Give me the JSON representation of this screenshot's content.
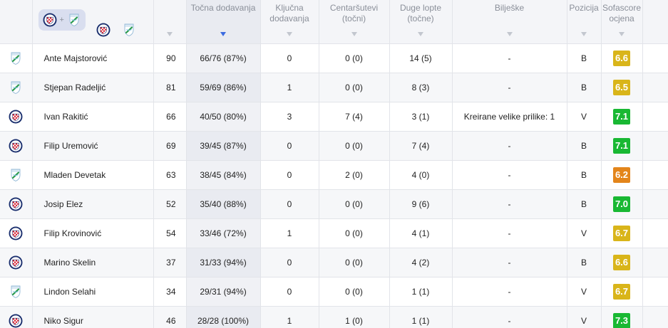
{
  "colors": {
    "rating_yellow": "#d9b51a",
    "rating_orange": "#e3851b",
    "rating_green": "#19b833",
    "sort_active": "#3b6be0"
  },
  "header": {
    "team_filter_plus": "+",
    "sort_column": "accurate_passes",
    "columns": {
      "minutes": "",
      "accurate_passes": "Točna dodavanja",
      "key_passes": "Ključna dodavanja",
      "crosses": "Centaršutevi (točni)",
      "long_balls": "Duge lopte (točne)",
      "notes": "Bilješke",
      "position": "Pozicija",
      "rating": "Sofascore ocjena"
    }
  },
  "players": [
    {
      "team": "rijeka",
      "name": "Ante Majstorović",
      "minutes": "90",
      "accurate_passes": "66/76 (87%)",
      "key_passes": "0",
      "crosses": "0 (0)",
      "long_balls": "14 (5)",
      "notes": "-",
      "position": "B",
      "rating": "6.6",
      "rating_color": "yellow"
    },
    {
      "team": "rijeka",
      "name": "Stjepan Radeljić",
      "minutes": "81",
      "accurate_passes": "59/69 (86%)",
      "key_passes": "1",
      "crosses": "0 (0)",
      "long_balls": "8 (3)",
      "notes": "-",
      "position": "B",
      "rating": "6.5",
      "rating_color": "yellow"
    },
    {
      "team": "hajduk",
      "name": "Ivan Rakitić",
      "minutes": "66",
      "accurate_passes": "40/50 (80%)",
      "key_passes": "3",
      "crosses": "7 (4)",
      "long_balls": "3 (1)",
      "notes": "Kreirane velike prilike: 1",
      "position": "V",
      "rating": "7.1",
      "rating_color": "green"
    },
    {
      "team": "hajduk",
      "name": "Filip Uremović",
      "minutes": "69",
      "accurate_passes": "39/45 (87%)",
      "key_passes": "0",
      "crosses": "0 (0)",
      "long_balls": "7 (4)",
      "notes": "-",
      "position": "B",
      "rating": "7.1",
      "rating_color": "green"
    },
    {
      "team": "rijeka",
      "name": "Mladen Devetak",
      "minutes": "63",
      "accurate_passes": "38/45 (84%)",
      "key_passes": "0",
      "crosses": "2 (0)",
      "long_balls": "4 (0)",
      "notes": "-",
      "position": "B",
      "rating": "6.2",
      "rating_color": "orange"
    },
    {
      "team": "hajduk",
      "name": "Josip Elez",
      "minutes": "52",
      "accurate_passes": "35/40 (88%)",
      "key_passes": "0",
      "crosses": "0 (0)",
      "long_balls": "9 (6)",
      "notes": "-",
      "position": "B",
      "rating": "7.0",
      "rating_color": "green"
    },
    {
      "team": "hajduk",
      "name": "Filip Krovinović",
      "minutes": "54",
      "accurate_passes": "33/46 (72%)",
      "key_passes": "1",
      "crosses": "0 (0)",
      "long_balls": "4 (1)",
      "notes": "-",
      "position": "V",
      "rating": "6.7",
      "rating_color": "yellow"
    },
    {
      "team": "hajduk",
      "name": "Marino Skelin",
      "minutes": "37",
      "accurate_passes": "31/33 (94%)",
      "key_passes": "0",
      "crosses": "0 (0)",
      "long_balls": "4 (2)",
      "notes": "-",
      "position": "B",
      "rating": "6.6",
      "rating_color": "yellow"
    },
    {
      "team": "rijeka",
      "name": "Lindon Selahi",
      "minutes": "34",
      "accurate_passes": "29/31 (94%)",
      "key_passes": "0",
      "crosses": "0 (0)",
      "long_balls": "1 (1)",
      "notes": "-",
      "position": "V",
      "rating": "6.7",
      "rating_color": "yellow"
    },
    {
      "team": "hajduk",
      "name": "Niko Sigur",
      "minutes": "46",
      "accurate_passes": "28/28 (100%)",
      "key_passes": "1",
      "crosses": "1 (0)",
      "long_balls": "1 (1)",
      "notes": "-",
      "position": "V",
      "rating": "7.3",
      "rating_color": "green"
    }
  ]
}
